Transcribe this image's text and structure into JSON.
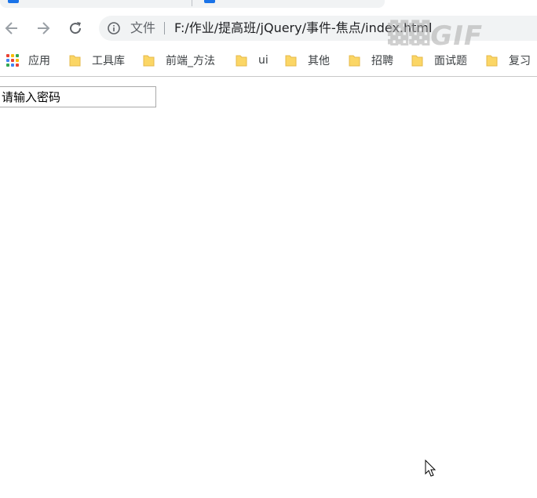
{
  "browser": {
    "address_bar": {
      "scheme_label": "文件",
      "url": "F:/作业/提高班/jQuery/事件-焦点/index.html",
      "watermark": "GIF"
    },
    "bookmarks": [
      {
        "label": "应用",
        "icon": "apps-grid-icon"
      },
      {
        "label": "工具库",
        "icon": "folder-icon"
      },
      {
        "label": "前端_方法",
        "icon": "folder-icon"
      },
      {
        "label": "ui",
        "icon": "folder-icon"
      },
      {
        "label": "其他",
        "icon": "folder-icon"
      },
      {
        "label": "招聘",
        "icon": "folder-icon"
      },
      {
        "label": "面试题",
        "icon": "folder-icon"
      },
      {
        "label": "复习",
        "icon": "folder-icon"
      }
    ]
  },
  "page": {
    "password_input": {
      "placeholder": "请输入密码",
      "value": ""
    }
  },
  "colors": {
    "accent": "#1a73e8",
    "folder": "#fbd665",
    "omnibox_bg": "#f1f3f4"
  }
}
